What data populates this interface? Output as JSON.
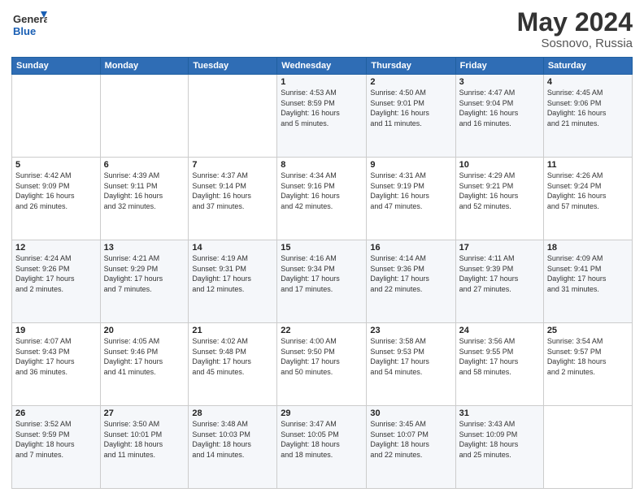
{
  "header": {
    "logo_general": "General",
    "logo_blue": "Blue",
    "title": "May 2024",
    "subtitle": "Sosnovo, Russia"
  },
  "columns": [
    "Sunday",
    "Monday",
    "Tuesday",
    "Wednesday",
    "Thursday",
    "Friday",
    "Saturday"
  ],
  "weeks": [
    [
      {
        "day": "",
        "detail": ""
      },
      {
        "day": "",
        "detail": ""
      },
      {
        "day": "",
        "detail": ""
      },
      {
        "day": "1",
        "detail": "Sunrise: 4:53 AM\nSunset: 8:59 PM\nDaylight: 16 hours\nand 5 minutes."
      },
      {
        "day": "2",
        "detail": "Sunrise: 4:50 AM\nSunset: 9:01 PM\nDaylight: 16 hours\nand 11 minutes."
      },
      {
        "day": "3",
        "detail": "Sunrise: 4:47 AM\nSunset: 9:04 PM\nDaylight: 16 hours\nand 16 minutes."
      },
      {
        "day": "4",
        "detail": "Sunrise: 4:45 AM\nSunset: 9:06 PM\nDaylight: 16 hours\nand 21 minutes."
      }
    ],
    [
      {
        "day": "5",
        "detail": "Sunrise: 4:42 AM\nSunset: 9:09 PM\nDaylight: 16 hours\nand 26 minutes."
      },
      {
        "day": "6",
        "detail": "Sunrise: 4:39 AM\nSunset: 9:11 PM\nDaylight: 16 hours\nand 32 minutes."
      },
      {
        "day": "7",
        "detail": "Sunrise: 4:37 AM\nSunset: 9:14 PM\nDaylight: 16 hours\nand 37 minutes."
      },
      {
        "day": "8",
        "detail": "Sunrise: 4:34 AM\nSunset: 9:16 PM\nDaylight: 16 hours\nand 42 minutes."
      },
      {
        "day": "9",
        "detail": "Sunrise: 4:31 AM\nSunset: 9:19 PM\nDaylight: 16 hours\nand 47 minutes."
      },
      {
        "day": "10",
        "detail": "Sunrise: 4:29 AM\nSunset: 9:21 PM\nDaylight: 16 hours\nand 52 minutes."
      },
      {
        "day": "11",
        "detail": "Sunrise: 4:26 AM\nSunset: 9:24 PM\nDaylight: 16 hours\nand 57 minutes."
      }
    ],
    [
      {
        "day": "12",
        "detail": "Sunrise: 4:24 AM\nSunset: 9:26 PM\nDaylight: 17 hours\nand 2 minutes."
      },
      {
        "day": "13",
        "detail": "Sunrise: 4:21 AM\nSunset: 9:29 PM\nDaylight: 17 hours\nand 7 minutes."
      },
      {
        "day": "14",
        "detail": "Sunrise: 4:19 AM\nSunset: 9:31 PM\nDaylight: 17 hours\nand 12 minutes."
      },
      {
        "day": "15",
        "detail": "Sunrise: 4:16 AM\nSunset: 9:34 PM\nDaylight: 17 hours\nand 17 minutes."
      },
      {
        "day": "16",
        "detail": "Sunrise: 4:14 AM\nSunset: 9:36 PM\nDaylight: 17 hours\nand 22 minutes."
      },
      {
        "day": "17",
        "detail": "Sunrise: 4:11 AM\nSunset: 9:39 PM\nDaylight: 17 hours\nand 27 minutes."
      },
      {
        "day": "18",
        "detail": "Sunrise: 4:09 AM\nSunset: 9:41 PM\nDaylight: 17 hours\nand 31 minutes."
      }
    ],
    [
      {
        "day": "19",
        "detail": "Sunrise: 4:07 AM\nSunset: 9:43 PM\nDaylight: 17 hours\nand 36 minutes."
      },
      {
        "day": "20",
        "detail": "Sunrise: 4:05 AM\nSunset: 9:46 PM\nDaylight: 17 hours\nand 41 minutes."
      },
      {
        "day": "21",
        "detail": "Sunrise: 4:02 AM\nSunset: 9:48 PM\nDaylight: 17 hours\nand 45 minutes."
      },
      {
        "day": "22",
        "detail": "Sunrise: 4:00 AM\nSunset: 9:50 PM\nDaylight: 17 hours\nand 50 minutes."
      },
      {
        "day": "23",
        "detail": "Sunrise: 3:58 AM\nSunset: 9:53 PM\nDaylight: 17 hours\nand 54 minutes."
      },
      {
        "day": "24",
        "detail": "Sunrise: 3:56 AM\nSunset: 9:55 PM\nDaylight: 17 hours\nand 58 minutes."
      },
      {
        "day": "25",
        "detail": "Sunrise: 3:54 AM\nSunset: 9:57 PM\nDaylight: 18 hours\nand 2 minutes."
      }
    ],
    [
      {
        "day": "26",
        "detail": "Sunrise: 3:52 AM\nSunset: 9:59 PM\nDaylight: 18 hours\nand 7 minutes."
      },
      {
        "day": "27",
        "detail": "Sunrise: 3:50 AM\nSunset: 10:01 PM\nDaylight: 18 hours\nand 11 minutes."
      },
      {
        "day": "28",
        "detail": "Sunrise: 3:48 AM\nSunset: 10:03 PM\nDaylight: 18 hours\nand 14 minutes."
      },
      {
        "day": "29",
        "detail": "Sunrise: 3:47 AM\nSunset: 10:05 PM\nDaylight: 18 hours\nand 18 minutes."
      },
      {
        "day": "30",
        "detail": "Sunrise: 3:45 AM\nSunset: 10:07 PM\nDaylight: 18 hours\nand 22 minutes."
      },
      {
        "day": "31",
        "detail": "Sunrise: 3:43 AM\nSunset: 10:09 PM\nDaylight: 18 hours\nand 25 minutes."
      },
      {
        "day": "",
        "detail": ""
      }
    ]
  ]
}
